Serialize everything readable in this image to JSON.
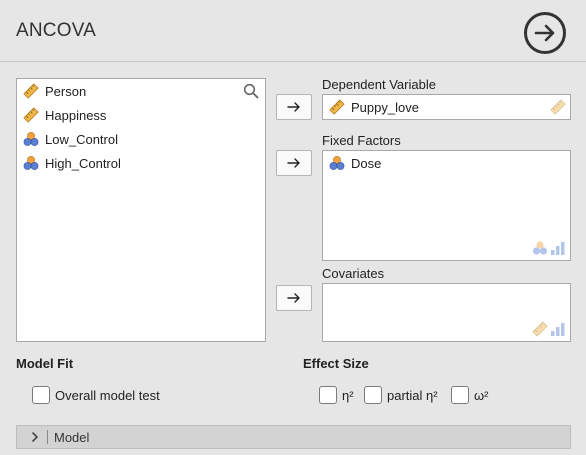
{
  "header": {
    "title": "ANCOVA"
  },
  "variables": [
    {
      "name": "Person",
      "icon": "ruler-icon"
    },
    {
      "name": "Happiness",
      "icon": "ruler-icon"
    },
    {
      "name": "Low_Control",
      "icon": "nominal-circles-icon"
    },
    {
      "name": "High_Control",
      "icon": "nominal-circles-icon"
    }
  ],
  "dependent": {
    "label": "Dependent Variable",
    "value": "Puppy_love"
  },
  "fixed_factors": {
    "label": "Fixed Factors",
    "value": "Dose"
  },
  "covariates": {
    "label": "Covariates"
  },
  "model_fit": {
    "title": "Model Fit",
    "overall_label": "Overall model test"
  },
  "effect_size": {
    "title": "Effect Size",
    "eta_label": "η²",
    "partial_eta_label": "partial η²",
    "omega_label": "ω²"
  },
  "model_section": {
    "label": "Model"
  },
  "colors": {
    "ruler": "#f0b84a",
    "nominal_orange": "#f2a23c",
    "nominal_blue": "#5b7fd4"
  }
}
